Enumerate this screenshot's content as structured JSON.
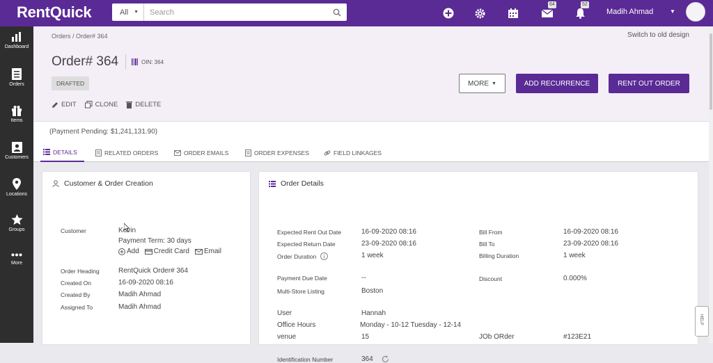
{
  "topbar": {
    "logo": "RentQuick",
    "search_scope": "All",
    "search_placeholder": "Search",
    "mail_badge": "64",
    "bell_badge": "52",
    "username": "Madih Ahmad"
  },
  "sidebar": {
    "items": [
      {
        "label": "Dashboard"
      },
      {
        "label": "Orders"
      },
      {
        "label": "Items"
      },
      {
        "label": "Customers"
      },
      {
        "label": "Locations"
      },
      {
        "label": "Groups"
      },
      {
        "label": "More"
      }
    ]
  },
  "header": {
    "breadcrumb": "Orders / Order# 364",
    "switch_link": "Switch to old design",
    "order_title": "Order# 364",
    "oin": "OIN: 364",
    "status": "DRAFTED",
    "edit": "EDIT",
    "clone": "CLONE",
    "delete": "DELETE",
    "more": "MORE",
    "add_recurrence": "ADD RECURRENCE",
    "rent_out": "RENT OUT ORDER"
  },
  "payment_pending": "(Payment Pending: $1,241,131.90)",
  "tabs": [
    "DETAILS",
    "RELATED ORDERS",
    "ORDER EMAILS",
    "ORDER EXPENSES",
    "FIELD LINKAGES"
  ],
  "customer_card": {
    "title": "Customer & Order Creation",
    "customer_label": "Customer",
    "customer_name": "Kevin",
    "payment_term": "Payment Term: 30 days",
    "add": "Add",
    "credit_card": "Credit Card",
    "email": "Email",
    "rows": [
      {
        "label": "Order Heading",
        "value": "RentQuick Order# 364"
      },
      {
        "label": "Created On",
        "value": "16-09-2020 08:16"
      },
      {
        "label": "Created By",
        "value": "Madih Ahmad"
      },
      {
        "label": "Assigned To",
        "value": "Madih Ahmad"
      }
    ]
  },
  "details_card": {
    "title": "Order Details",
    "left": [
      {
        "label": "Expected Rent Out Date",
        "value": "16-09-2020 08:16"
      },
      {
        "label": "Expected Return Date",
        "value": "23-09-2020 08:16"
      },
      {
        "label": "Order Duration",
        "value": "1 week"
      },
      {
        "label": "Payment Due Date",
        "value": "--"
      },
      {
        "label": "Multi-Store Listing",
        "value": "Boston"
      },
      {
        "label": "User",
        "value": "Hannah"
      },
      {
        "label": "Office Hours",
        "value": "Monday - 10-12 Tuesday - 12-14"
      },
      {
        "label": "venue",
        "value": "15"
      },
      {
        "label": "Identification Number",
        "value": "364"
      }
    ],
    "right": [
      {
        "label": "Bill From",
        "value": "16-09-2020 08:16"
      },
      {
        "label": "Bill To",
        "value": "23-09-2020 08:16"
      },
      {
        "label": "Billing Duration",
        "value": "1 week"
      },
      {
        "label": "Discount",
        "value": "0.000%"
      },
      {
        "label": "JOb ORder",
        "value": "#123E21"
      }
    ]
  },
  "help": "HELP"
}
